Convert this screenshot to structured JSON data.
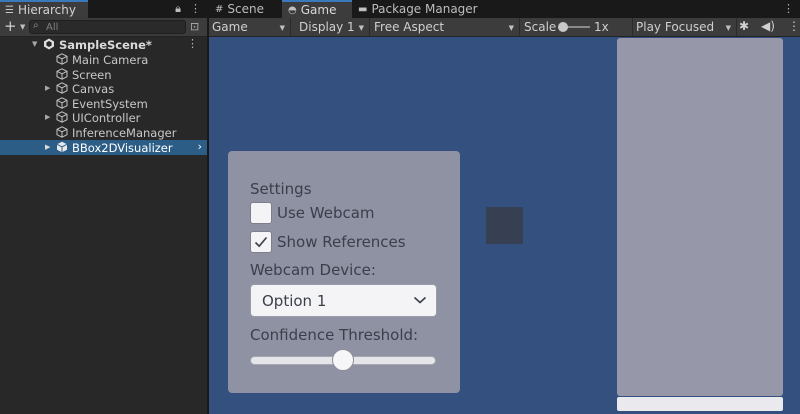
{
  "hierarchy": {
    "tab_label": "Hierarchy",
    "search_placeholder": "All",
    "scene_name": "SampleScene*",
    "items": [
      {
        "label": "Main Camera"
      },
      {
        "label": "Screen"
      },
      {
        "label": "Canvas"
      },
      {
        "label": "EventSystem"
      },
      {
        "label": "UIController"
      },
      {
        "label": "InferenceManager"
      },
      {
        "label": "BBox2DVisualizer"
      }
    ],
    "selected_item": "BBox2DVisualizer"
  },
  "tabs": [
    {
      "label": "Scene",
      "icon": "grid-icon"
    },
    {
      "label": "Game",
      "icon": "gamepad-icon"
    },
    {
      "label": "Package Manager",
      "icon": "package-icon"
    }
  ],
  "active_tab": "Game",
  "toolbar": {
    "view_mode": "Game",
    "display": "Display 1",
    "aspect": "Free Aspect",
    "scale_label": "Scale",
    "scale_value": "1x",
    "scale_fraction": 0.1,
    "play_mode": "Play Focused"
  },
  "settings_panel": {
    "title": "Settings",
    "use_webcam_label": "Use Webcam",
    "use_webcam_checked": false,
    "show_references_label": "Show References",
    "show_references_checked": true,
    "webcam_device_label": "Webcam Device:",
    "webcam_device_value": "Option 1",
    "confidence_label": "Confidence Threshold:",
    "confidence_fraction": 0.5
  },
  "colors": {
    "accent": "#3a79bb",
    "selection": "#2c5d87",
    "viewport": "#33507f",
    "panel": "#8f92a2"
  }
}
